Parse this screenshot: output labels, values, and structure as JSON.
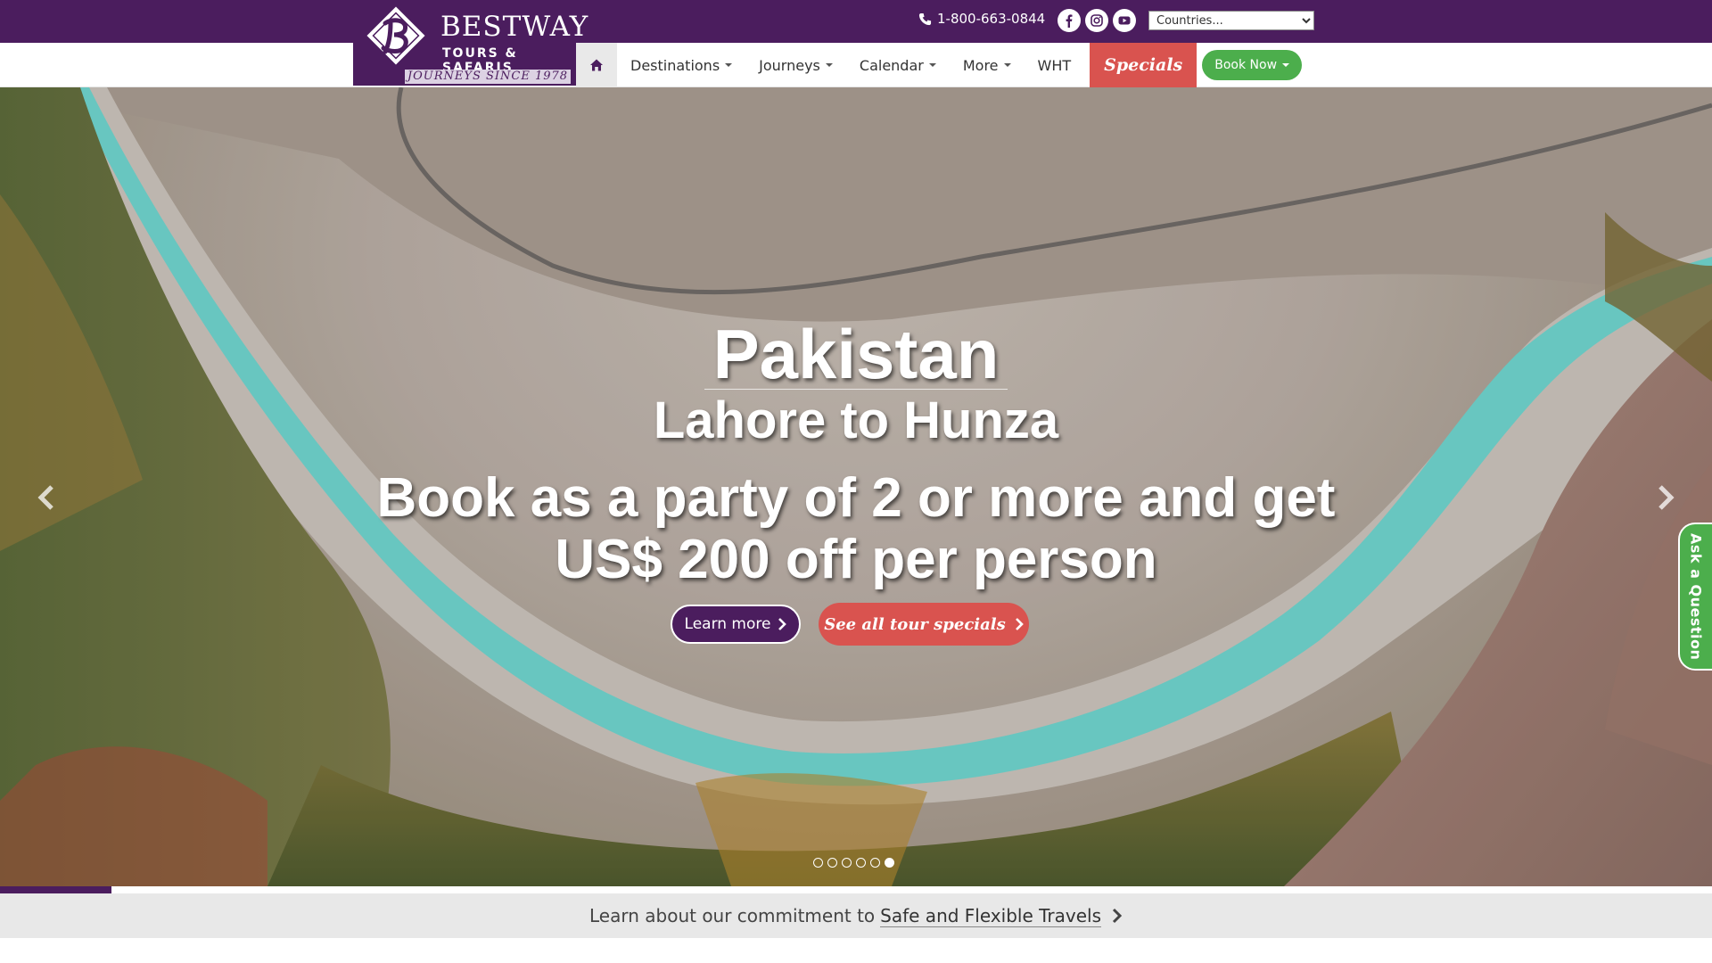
{
  "header": {
    "phone": "1-800-663-0844",
    "social": [
      "facebook-icon",
      "instagram-icon",
      "youtube-icon"
    ],
    "country_select": {
      "value": "Countries..."
    }
  },
  "logo": {
    "brand": "BESTWAY",
    "sub": "TOURS & SAFARIS",
    "since": "JOURNEYS SINCE 1978"
  },
  "nav": {
    "items": [
      {
        "label": "Destinations",
        "dropdown": true
      },
      {
        "label": "Journeys",
        "dropdown": true
      },
      {
        "label": "Calendar",
        "dropdown": true
      },
      {
        "label": "More",
        "dropdown": true
      },
      {
        "label": "WHT",
        "dropdown": false
      }
    ],
    "specials": "Specials",
    "book_now": "Book Now"
  },
  "hero": {
    "title": "Pakistan",
    "subtitle": "Lahore to Hunza",
    "offer_line1": "Book as a party of 2 or more and get",
    "offer_line2": "US$ 200 off per person",
    "learn_more": "Learn more",
    "see_specials": "See all tour specials",
    "slides": 6,
    "active_slide": 6,
    "progress": 0.065
  },
  "ask_question": "Ask a Question",
  "info_bar": {
    "prefix": "Learn about our commitment to",
    "link": "Safe and Flexible Travels"
  },
  "colors": {
    "brand_purple": "#4b1d5e",
    "specials_red": "#d9534f",
    "book_green": "#4cae4c",
    "river_turquoise": "#6fd3cc"
  }
}
